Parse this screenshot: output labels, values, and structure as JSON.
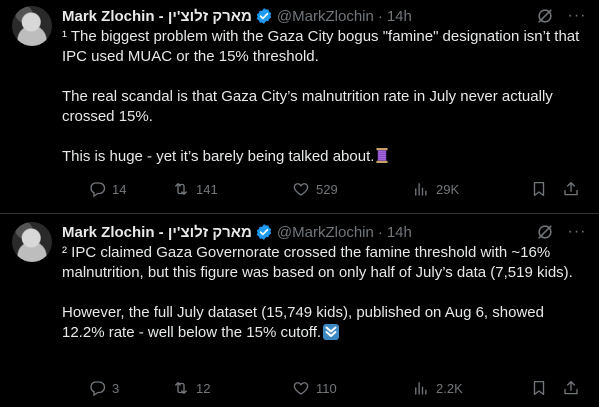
{
  "tweets": [
    {
      "author_name": "Mark Zlochin - מארק זלוצ'ין",
      "handle": "@MarkZlochin",
      "time": "14h",
      "paragraphs": [
        "¹ The biggest problem with the Gaza City bogus \"famine\" designation isn’t that IPC used MUAC or the 15% threshold.",
        "The real scandal is that Gaza City’s malnutrition rate in July never actually crossed 15%.",
        "This is huge - yet it’s barely being talked about."
      ],
      "trailing_emoji": "spool-of-thread-emoji",
      "replies": "14",
      "reposts": "141",
      "likes": "529",
      "views": "29K"
    },
    {
      "author_name": "Mark Zlochin - מארק זלוצ'ין",
      "handle": "@MarkZlochin",
      "time": "14h",
      "paragraphs": [
        "² IPC claimed Gaza Governorate crossed the famine threshold with ~16% malnutrition, but this figure was based on only half of July’s data (7,519 kids).",
        "However, the full July dataset (15,749 kids), published on Aug 6, showed 12.2% rate - well below the 15% cutoff."
      ],
      "trailing_emoji": "double-down-arrow-emoji",
      "replies": "3",
      "reposts": "12",
      "likes": "110",
      "views": "2.2K"
    }
  ],
  "colors": {
    "background": "#000000",
    "text": "#e7e9ea",
    "muted": "#71767b",
    "verified": "#1d9bf0",
    "divider": "#2f3336"
  }
}
